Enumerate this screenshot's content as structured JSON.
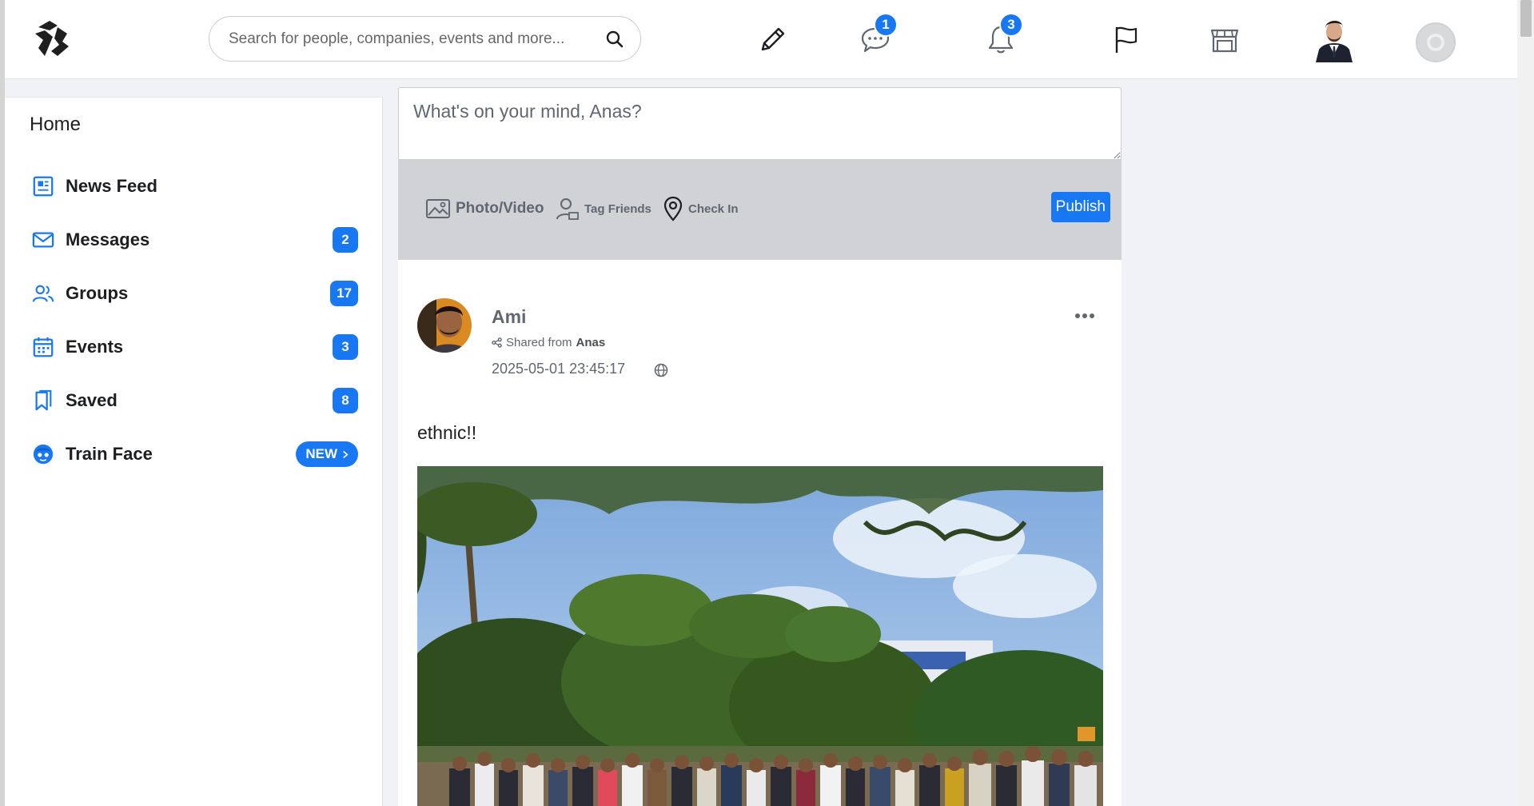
{
  "search": {
    "placeholder": "Search for people, companies, events and more..."
  },
  "header": {
    "messages_badge": "1",
    "notifications_badge": "3"
  },
  "sidebar": {
    "title": "Home",
    "items": [
      {
        "label": "News Feed",
        "icon": "newspaper-icon"
      },
      {
        "label": "Messages",
        "count": "2",
        "icon": "envelope-icon"
      },
      {
        "label": "Groups",
        "count": "17",
        "icon": "users-icon"
      },
      {
        "label": "Events",
        "count": "3",
        "icon": "calendar-icon"
      },
      {
        "label": "Saved",
        "count": "8",
        "icon": "bookmark-icon"
      },
      {
        "label": "Train Face",
        "badge": "NEW",
        "icon": "face-icon"
      }
    ]
  },
  "composer": {
    "placeholder": "What's on your mind, Anas?",
    "photo_video": "Photo/Video",
    "tag_friends": "Tag Friends",
    "check_in": "Check In",
    "publish": "Publish"
  },
  "post": {
    "author": "Ami",
    "shared_prefix": "Shared from",
    "shared_from": "Anas",
    "timestamp": "2025-05-01 23:45:17",
    "text": "ethnic!!"
  },
  "colors": {
    "accent": "#1877f2",
    "composer_bar": "#d0d2d5",
    "page_bg": "#f0f2f5"
  }
}
